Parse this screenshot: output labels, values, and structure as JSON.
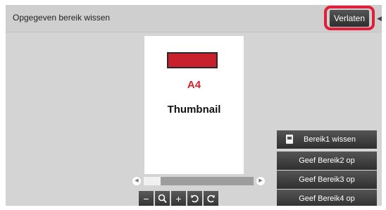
{
  "header": {
    "title": "Opgegeven bereik wissen",
    "exit_label": "Verlaten"
  },
  "preview": {
    "paper_size": "A4",
    "thumbnail_label": "Thumbnail"
  },
  "ranges": [
    {
      "label": "Bereik1 wissen",
      "icon": "document-icon"
    },
    {
      "label": "Geef Bereik2 op"
    },
    {
      "label": "Geef Bereik3 op"
    },
    {
      "label": "Geef Bereik4 op"
    }
  ],
  "toolbar": {
    "zoom_out": "−",
    "zoom_in": "+"
  },
  "colors": {
    "highlight": "#e0203a",
    "paper_size_text": "#d8212f",
    "button_bg": "#3a3a3a",
    "screen_bg": "#d4d4d4"
  }
}
